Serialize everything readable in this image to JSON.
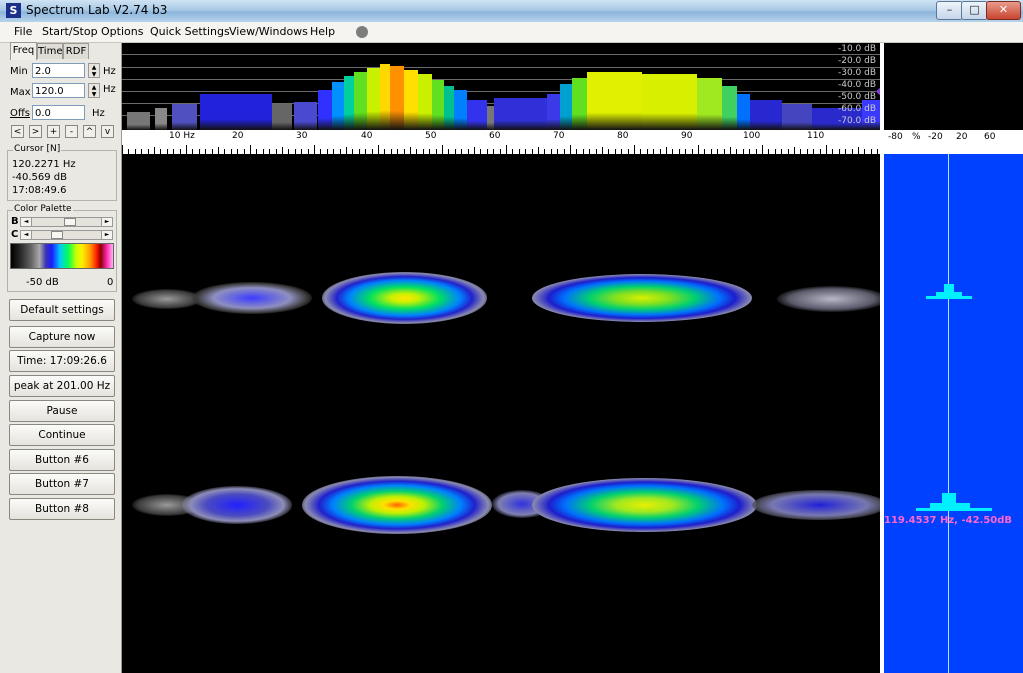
{
  "window": {
    "title": "Spectrum Lab V2.74 b3",
    "icon": "app-icon",
    "min_label": "–",
    "max_label": "□",
    "close_label": "✕"
  },
  "menu": [
    "File",
    "Start/Stop",
    "Options",
    "Quick Settings",
    "View/Windows",
    "Help"
  ],
  "left_panel": {
    "tabs": [
      "Freq",
      "Time",
      "RDF"
    ],
    "min_label": "Min",
    "min_value": "2.0",
    "min_unit": "Hz",
    "max_label": "Max",
    "max_value": "120.0",
    "max_unit": "Hz",
    "offs_label": "Offs",
    "offs_value": "0.0",
    "offs_unit": "Hz",
    "nav_buttons": [
      "<",
      ">",
      "+",
      "-",
      "^",
      "v"
    ],
    "cursor": {
      "title": "Cursor [N]",
      "freq": "120.2271 Hz",
      "level": "-40.569 dB",
      "time": "17:08:49.6"
    },
    "palette": {
      "title": "Color Palette",
      "b_label": "B",
      "c_label": "C",
      "min_label": "-50 dB",
      "max_label": "0"
    },
    "buttons": [
      "Default settings",
      "Capture now",
      "Time:  17:09:26.6",
      "peak at 201.00 Hz",
      "Pause",
      "Continue",
      "Button #6",
      "Button #7",
      "Button #8"
    ]
  },
  "spectrum": {
    "db_labels": [
      "-10.0 dB",
      "-20.0 dB",
      "-30.0 dB",
      "-40.0 dB",
      "-50.0 dB",
      "-60.0 dB",
      "-70.0 dB"
    ],
    "freq_labels": [
      "10 Hz",
      "20",
      "30",
      "40",
      "50",
      "60",
      "70",
      "80",
      "90",
      "100",
      "110"
    ]
  },
  "right_panel": {
    "scale_labels": [
      "-80",
      "%",
      "-20",
      "20",
      "60"
    ],
    "peak_readout": "119.4537 Hz, -42.50dB"
  },
  "colors": {
    "waterfall_bg": "#000000",
    "side_panel": "#0040ff",
    "readout": "#ff66cc"
  }
}
